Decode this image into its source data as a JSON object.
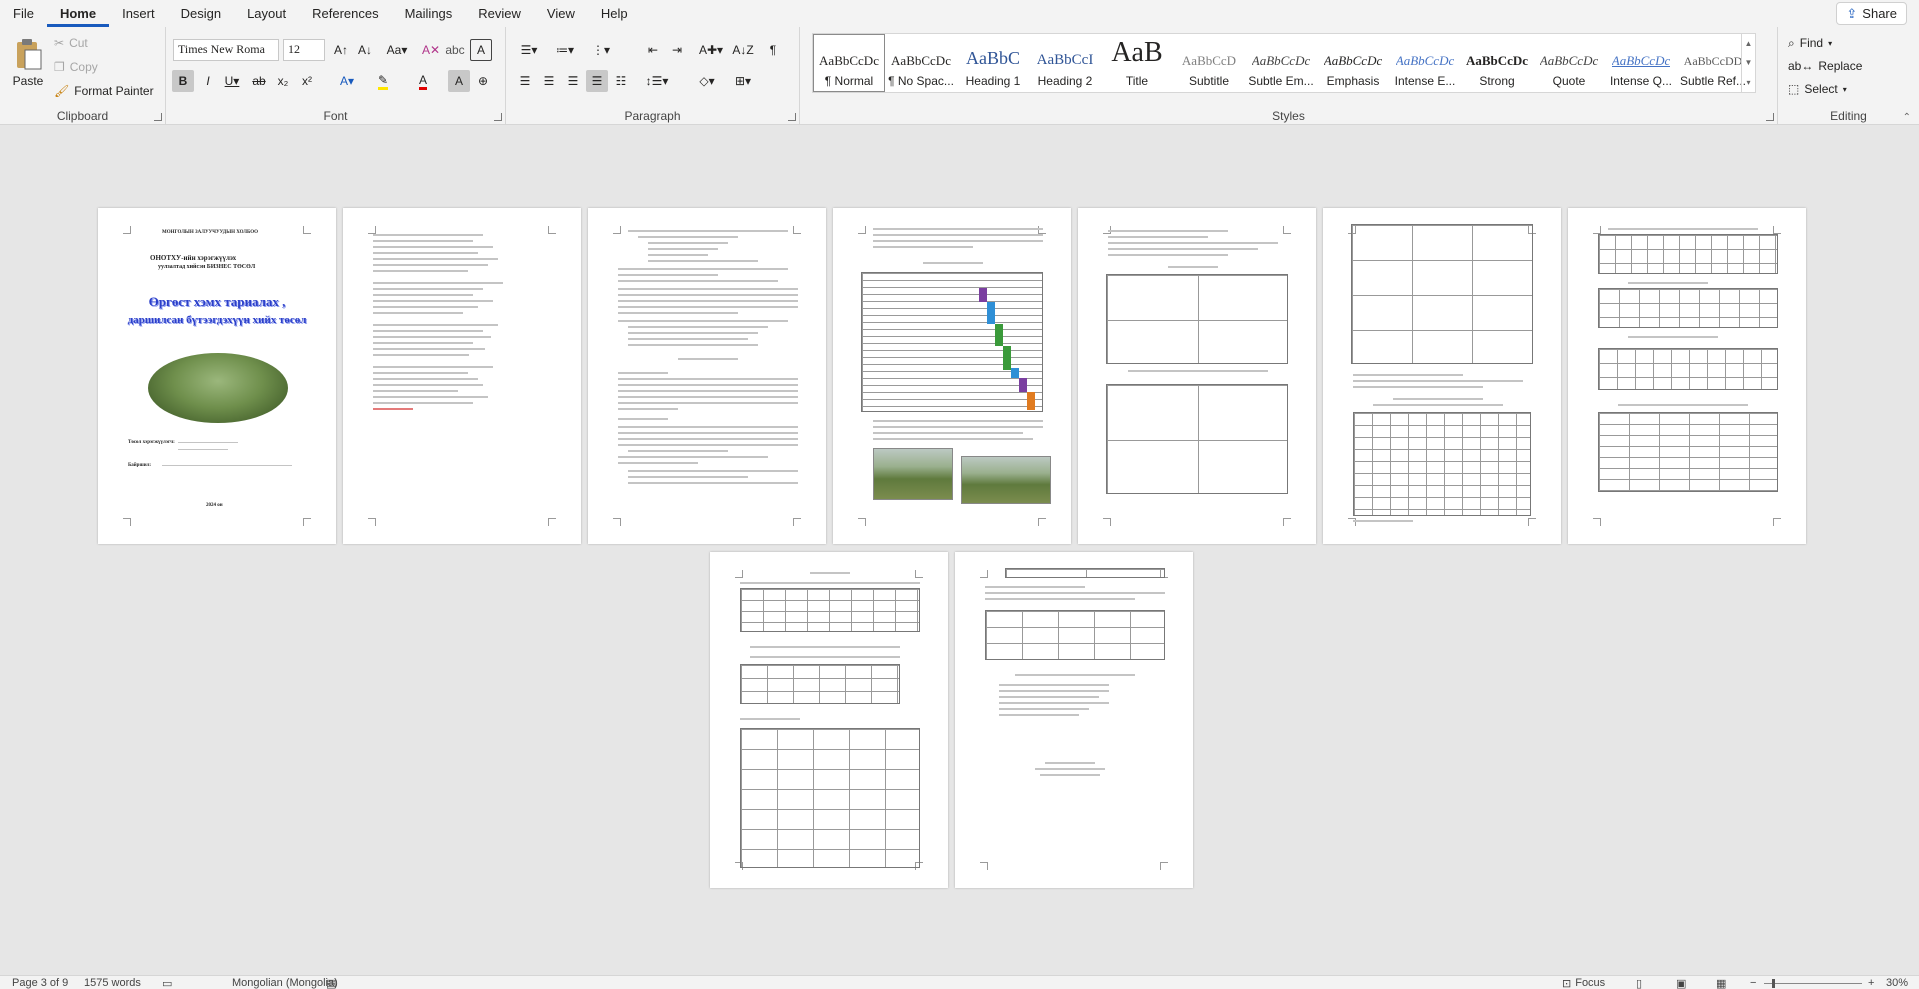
{
  "menu": [
    "File",
    "Home",
    "Insert",
    "Design",
    "Layout",
    "References",
    "Mailings",
    "Review",
    "View",
    "Help"
  ],
  "active_tab": "Home",
  "share_label": "Share",
  "clipboard": {
    "paste": "Paste",
    "cut": "Cut",
    "copy": "Copy",
    "format_painter": "Format Painter",
    "label": "Clipboard"
  },
  "font": {
    "name": "Times New Roma",
    "size": "12",
    "label": "Font"
  },
  "paragraph": {
    "label": "Paragraph"
  },
  "styles": {
    "label": "Styles",
    "items": [
      {
        "preview": "AaBbCcDc",
        "name": "¶ Normal"
      },
      {
        "preview": "AaBbCcDc",
        "name": "¶ No Spac..."
      },
      {
        "preview": "AaBbC",
        "name": "Heading 1"
      },
      {
        "preview": "AaBbCcI",
        "name": "Heading 2"
      },
      {
        "preview": "AaB",
        "name": "Title"
      },
      {
        "preview": "AaBbCcD",
        "name": "Subtitle"
      },
      {
        "preview": "AaBbCcDc",
        "name": "Subtle Em..."
      },
      {
        "preview": "AaBbCcDc",
        "name": "Emphasis"
      },
      {
        "preview": "AaBbCcDc",
        "name": "Intense E..."
      },
      {
        "preview": "AaBbCcDc",
        "name": "Strong"
      },
      {
        "preview": "AaBbCcDc",
        "name": "Quote"
      },
      {
        "preview": "AaBbCcDc",
        "name": "Intense Q..."
      },
      {
        "preview": "AaBbCcDD",
        "name": "Subtle Ref..."
      }
    ]
  },
  "editing": {
    "find": "Find",
    "replace": "Replace",
    "select": "Select",
    "label": "Editing"
  },
  "cover": {
    "header": "МОНГОЛЫН ЗАЛУУЧУУДЫН ХОЛБОО",
    "subtitle1": "ОНОТХУ-ийн хэрэгжүүлэх",
    "subtitle2": "уулзалтад хийсэн БИЗНЕС ТӨСӨЛ",
    "title1": "Өргөст хэмх тариалах ,",
    "title2": "даршилсан бүтээгдэхүүн хийх төсөл",
    "author_label": "Төсөл хэрэгжүүлэгч:",
    "advisor_label": "Байршил:",
    "year": "2024 он"
  },
  "status": {
    "page": "Page 3 of 9",
    "words": "1575 words",
    "language": "Mongolian (Mongolia)",
    "focus": "Focus",
    "zoom": "30%"
  }
}
